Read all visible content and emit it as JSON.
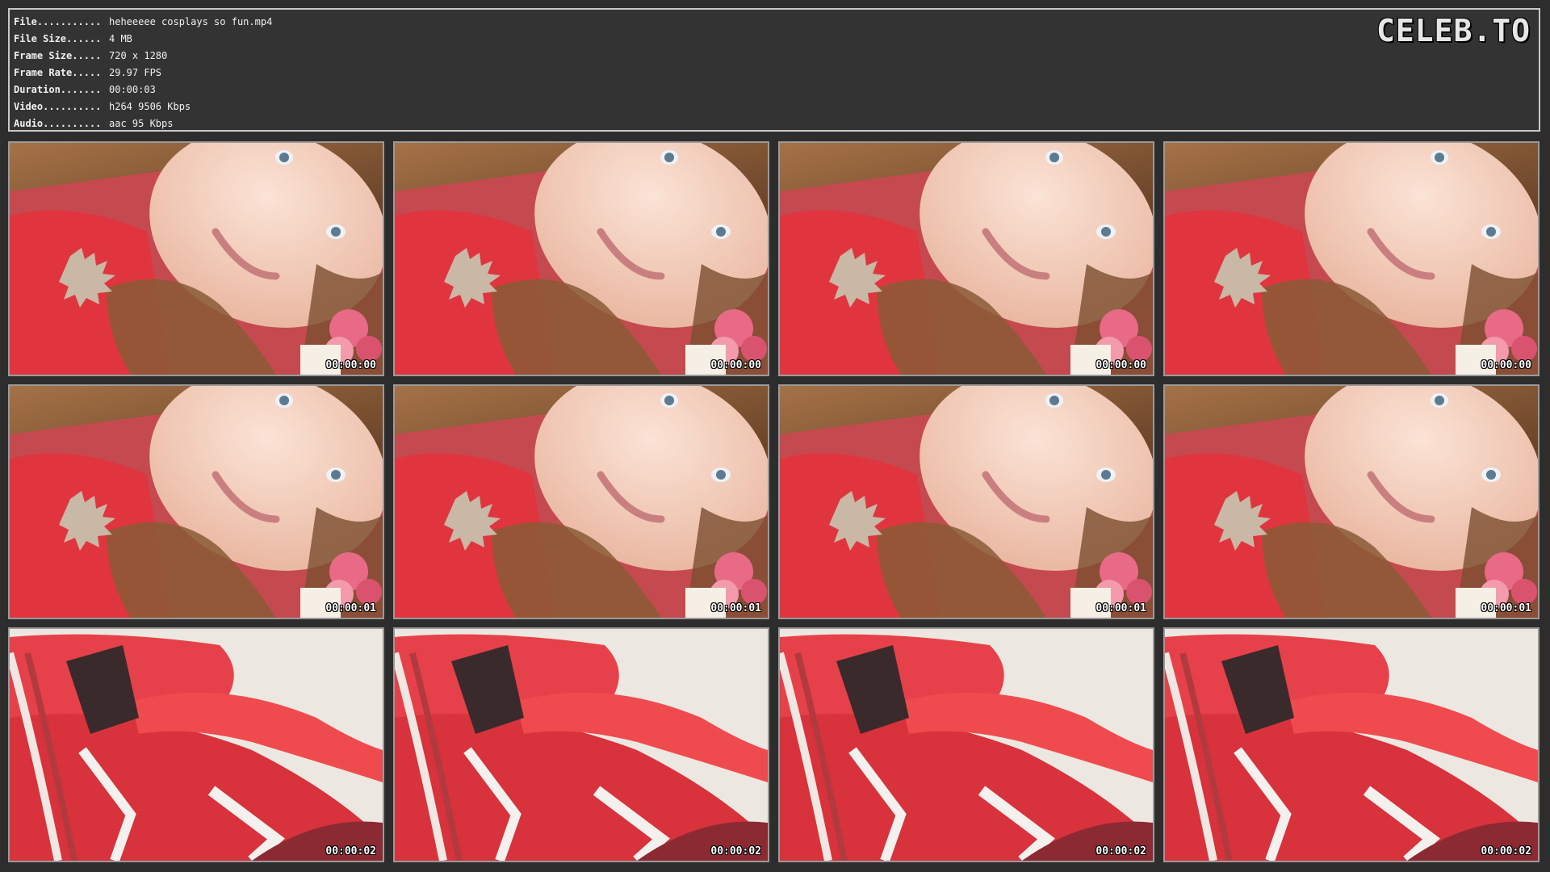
{
  "header": {
    "logo_text": "CELEB.TO",
    "metadata": [
      {
        "label": "File...........",
        "value": "heheeeee cosplays so fun.mp4"
      },
      {
        "label": "File Size......",
        "value": "4 MB"
      },
      {
        "label": "Frame Size.....",
        "value": "720 x 1280"
      },
      {
        "label": "Frame Rate.....",
        "value": "29.97 FPS"
      },
      {
        "label": "Duration.......",
        "value": "00:00:03"
      },
      {
        "label": "Video..........",
        "value": "h264 9506 Kbps"
      },
      {
        "label": "Audio..........",
        "value": "aac 95 Kbps"
      }
    ]
  },
  "thumbnails": {
    "rows": [
      {
        "scene": "face",
        "timestamps": [
          "00:00:00",
          "00:00:00",
          "00:00:00",
          "00:00:00"
        ]
      },
      {
        "scene": "face",
        "timestamps": [
          "00:00:01",
          "00:00:01",
          "00:00:01",
          "00:00:01"
        ]
      },
      {
        "scene": "suit",
        "timestamps": [
          "00:00:02",
          "00:00:02",
          "00:00:02",
          "00:00:02"
        ]
      }
    ]
  },
  "colors": {
    "background": "#2d2d2d",
    "panel": "#333333",
    "suit_red": "#e0353f",
    "skin": "#f2c9b8",
    "hair": "#8a5a36"
  }
}
